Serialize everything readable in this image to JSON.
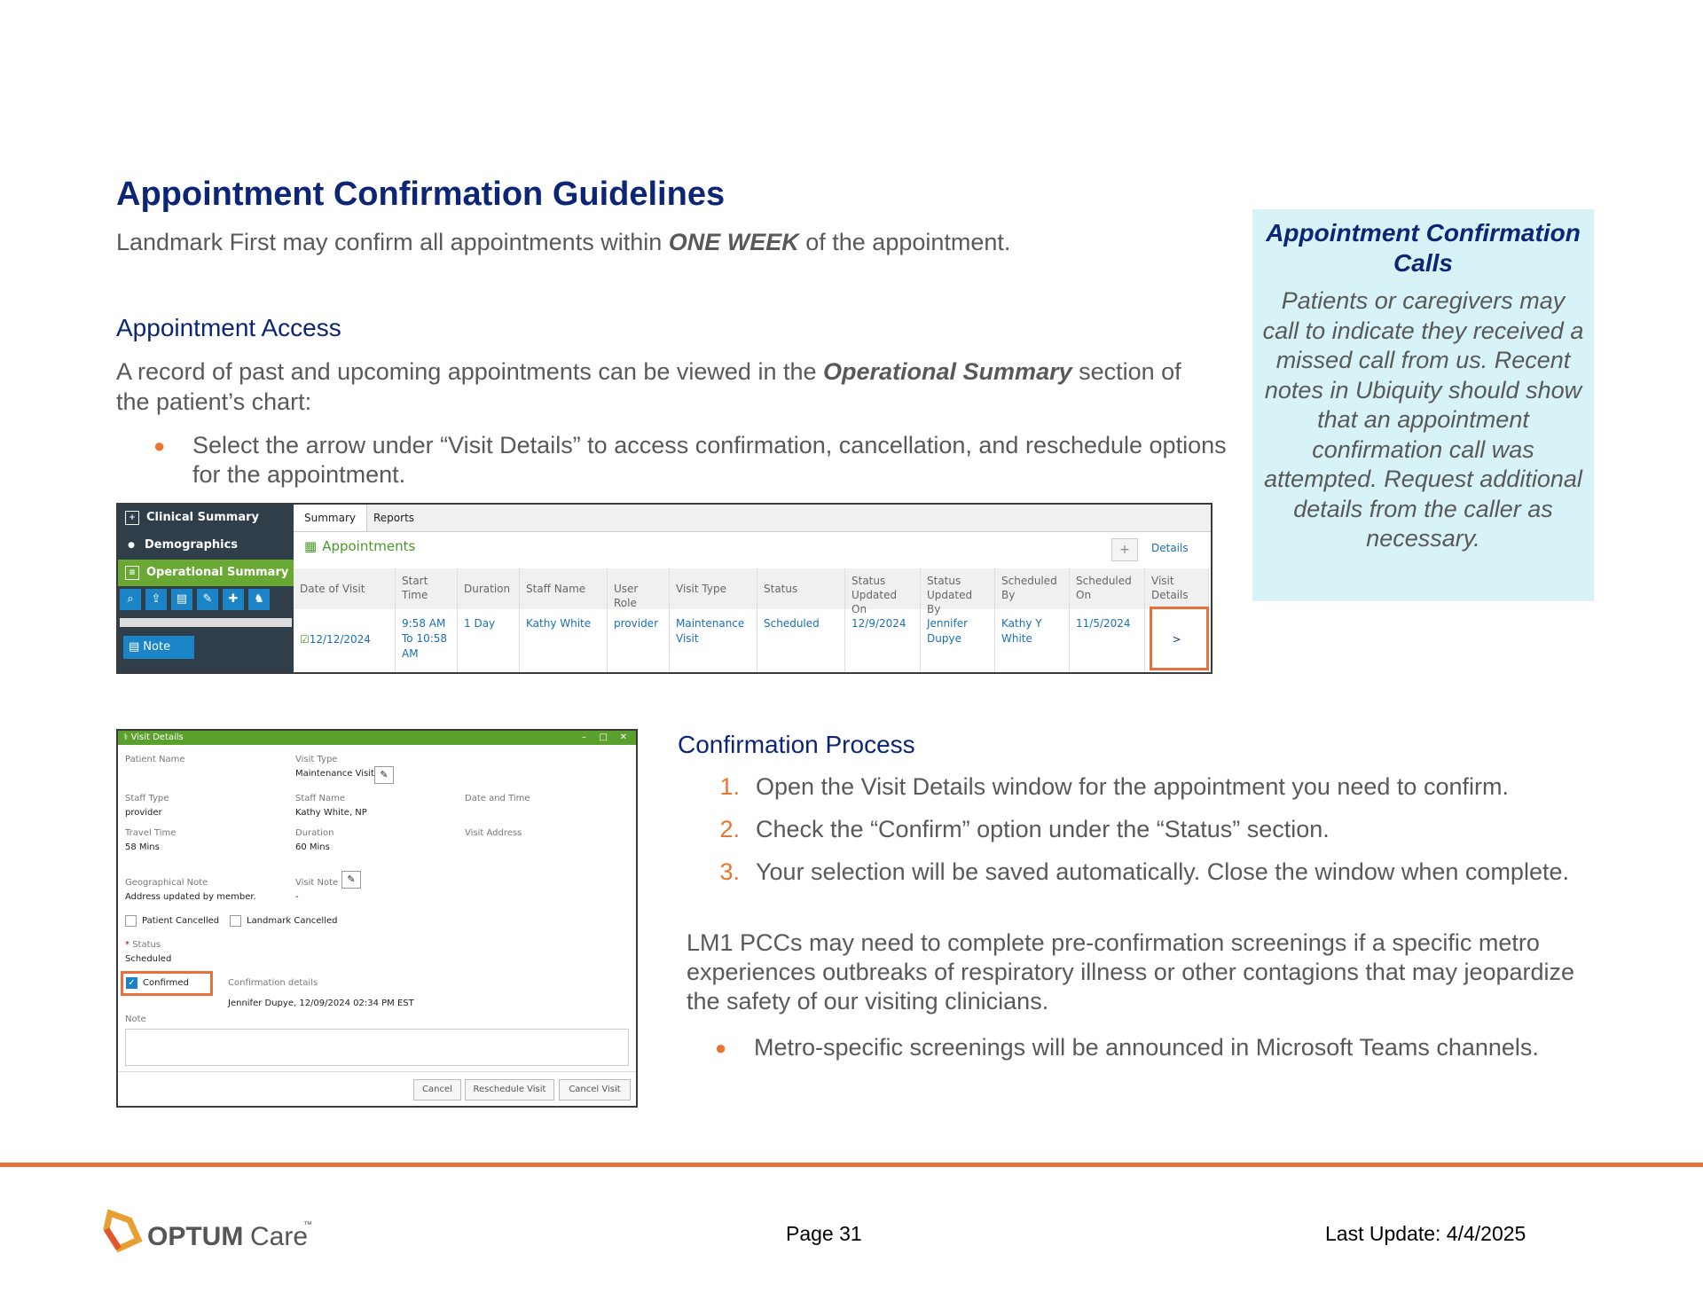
{
  "title": "Appointment Confirmation Guidelines",
  "intro": {
    "before": "Landmark First may confirm all appointments within ",
    "emph": "ONE WEEK",
    "after": " of the appointment."
  },
  "access": {
    "heading": "Appointment Access",
    "text_before": "A record of past and upcoming appointments can be viewed in the ",
    "text_emph": "Operational Summary",
    "text_after": " section of the patient’s chart:",
    "bullet": "Select the arrow under “Visit Details” to access confirmation, cancellation, and reschedule options for the appointment."
  },
  "callout": {
    "title": "Appointment Confirmation Calls",
    "body": "Patients or caregivers may call to indicate they received a missed call from us. Recent notes in Ubiquity should show that an appointment confirmation call was attempted. Request additional details from the caller as necessary."
  },
  "app": {
    "sidebar": [
      "Clinical Summary",
      "Demographics",
      "Operational Summary"
    ],
    "note_button": "Note",
    "tabs": [
      "Summary",
      "Reports"
    ],
    "section_title": "Appointments",
    "plus": "+",
    "details_link": "Details",
    "columns": [
      "Date of Visit",
      "Start Time",
      "Duration",
      "Staff Name",
      "User Role",
      "Visit Type",
      "Status",
      "Status Updated On",
      "Status Updated By",
      "Scheduled By",
      "Scheduled On",
      "Visit Details"
    ],
    "row": [
      "12/12/2024",
      "9:58 AM To 10:58 AM",
      "1 Day",
      "Kathy White",
      "provider",
      "Maintenance Visit",
      "Scheduled",
      "12/9/2024",
      "Jennifer Dupye",
      "Kathy Y White",
      "11/5/2024",
      ">"
    ]
  },
  "visit_window": {
    "title": "Visit Details",
    "controls": [
      "–",
      "□",
      "✕"
    ],
    "patient_name_label": "Patient Name",
    "visit_type_label": "Visit Type",
    "visit_type": "Maintenance Visit",
    "staff_type_label": "Staff Type",
    "staff_type": "provider",
    "staff_name_label": "Staff Name",
    "staff_name": "Kathy White, NP",
    "date_time_label": "Date and Time",
    "travel_time_label": "Travel Time",
    "travel_time": "58 Mins",
    "duration_label": "Duration",
    "duration": "60 Mins",
    "visit_address_label": "Visit Address",
    "geo_note_label": "Geographical Note",
    "geo_note": "Address updated by member.",
    "visit_note_label": "Visit Note",
    "visit_note": "-",
    "patient_cancelled": "Patient Cancelled",
    "landmark_cancelled": "Landmark Cancelled",
    "required_mark": "*",
    "status_label": "Status",
    "status": "Scheduled",
    "confirmed": "Confirmed",
    "confirmation_label": "Confirmation details",
    "confirmation": "Jennifer Dupye, 12/09/2024 02:34 PM EST",
    "note_label": "Note",
    "buttons": [
      "Cancel",
      "Reschedule Visit",
      "Cancel Visit"
    ]
  },
  "process": {
    "heading": "Confirmation Process",
    "steps": [
      "Open the Visit Details window for the appointment you need to confirm.",
      "Check the “Confirm” option under the “Status” section.",
      "Your selection will be saved automatically. Close the window when complete."
    ],
    "paragraph": "LM1 PCCs may need to complete pre-confirmation screenings if a specific metro experiences outbreaks of respiratory illness or other contagions that may jeopardize the safety of our visiting clinicians.",
    "bullet": "Metro-specific screenings will be announced in Microsoft Teams channels."
  },
  "footer": {
    "logo_main": "OPTUM",
    "logo_sub": "Care",
    "logo_tm": "™",
    "page": "Page 31",
    "updated": "Last Update: 4/4/2025"
  },
  "colors": {
    "heading": "#0c2577",
    "accent": "#e87530",
    "callout_bg": "#d7f3f7",
    "app_green": "#5aa02c",
    "app_link": "#1a6fb6"
  }
}
